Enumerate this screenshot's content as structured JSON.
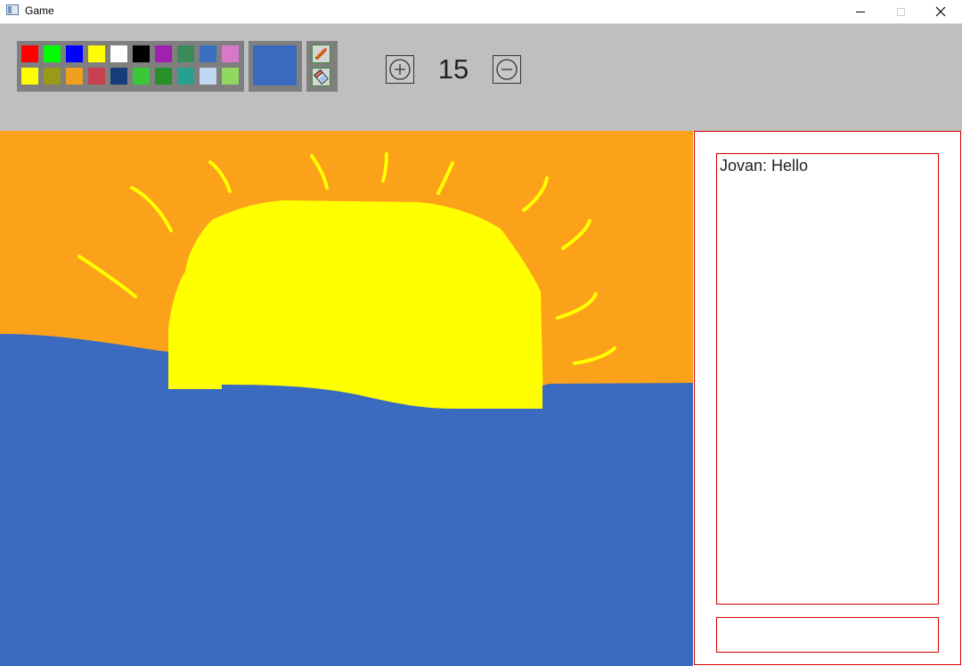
{
  "window": {
    "title": "Game",
    "icons": {
      "app": "app-icon",
      "minimize": "minimize-icon",
      "maximize": "maximize-icon",
      "close": "close-icon"
    }
  },
  "toolbar": {
    "palette": {
      "row1": [
        "#ff0000",
        "#00ff00",
        "#0000ff",
        "#ffff00",
        "#ffffff",
        "#000000",
        "#a020b0",
        "#3a8a5a",
        "#3a6ec0",
        "#d878c8"
      ],
      "row2": [
        "#ffff00",
        "#9a9a18",
        "#f0a020",
        "#c84050",
        "#183c78",
        "#38c838",
        "#289028",
        "#28a090",
        "#c0d8f0",
        "#90d860"
      ]
    },
    "current_color": "#3a6bc0",
    "tools": [
      {
        "name": "pencil",
        "icon": "pencil-icon"
      },
      {
        "name": "eraser",
        "icon": "eraser-icon"
      }
    ],
    "brush_size": "15",
    "increase_icon": "plus-circle-icon",
    "decrease_icon": "minus-circle-icon"
  },
  "canvas": {
    "background": "#fca11a",
    "sea_color": "#3a6bc0",
    "sun_color": "#ffff00"
  },
  "chat": {
    "messages": [
      {
        "text": "Jovan: Hello"
      }
    ],
    "input_value": "",
    "border_color": "#d40000"
  }
}
